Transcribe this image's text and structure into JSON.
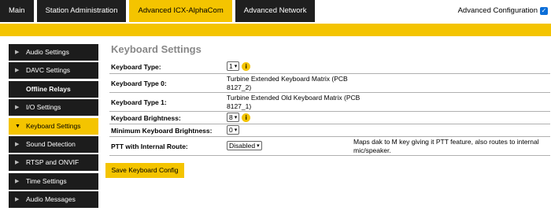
{
  "tabs": [
    {
      "label": "Main"
    },
    {
      "label": "Station Administration"
    },
    {
      "label": "Advanced ICX-AlphaCom"
    },
    {
      "label": "Advanced Network"
    }
  ],
  "advanced_config": {
    "label": "Advanced Configuration",
    "checked": true
  },
  "sidebar": {
    "items": [
      {
        "label": "Audio Settings"
      },
      {
        "label": "DAVC Settings"
      },
      {
        "label": "Offline Relays"
      },
      {
        "label": "I/O Settings"
      },
      {
        "label": "Keyboard Settings"
      },
      {
        "label": "Sound Detection"
      },
      {
        "label": "RTSP and ONVIF"
      },
      {
        "label": "Time Settings"
      },
      {
        "label": "Audio Messages"
      }
    ]
  },
  "main": {
    "title": "Keyboard Settings",
    "rows": [
      {
        "label": "Keyboard Type:",
        "value": "1"
      },
      {
        "label": "Keyboard Type 0:",
        "value": "Turbine Extended Keyboard Matrix (PCB 8127_2)"
      },
      {
        "label": "Keyboard Type 1:",
        "value": "Turbine Extended Old Keyboard Matrix (PCB 8127_1)"
      },
      {
        "label": "Keyboard Brightness:",
        "value": "8"
      },
      {
        "label": "Minimum Keyboard Brightness:",
        "value": "0"
      },
      {
        "label": "PTT with Internal Route:",
        "value": "Disabled",
        "description": "Maps dak to M key giving it PTT feature, also routes to internal mic/speaker."
      }
    ],
    "save_label": "Save Keyboard Config"
  },
  "colors": {
    "accent": "#f4c400",
    "dark": "#1c1c1c",
    "info_icon": "#f4c400"
  }
}
